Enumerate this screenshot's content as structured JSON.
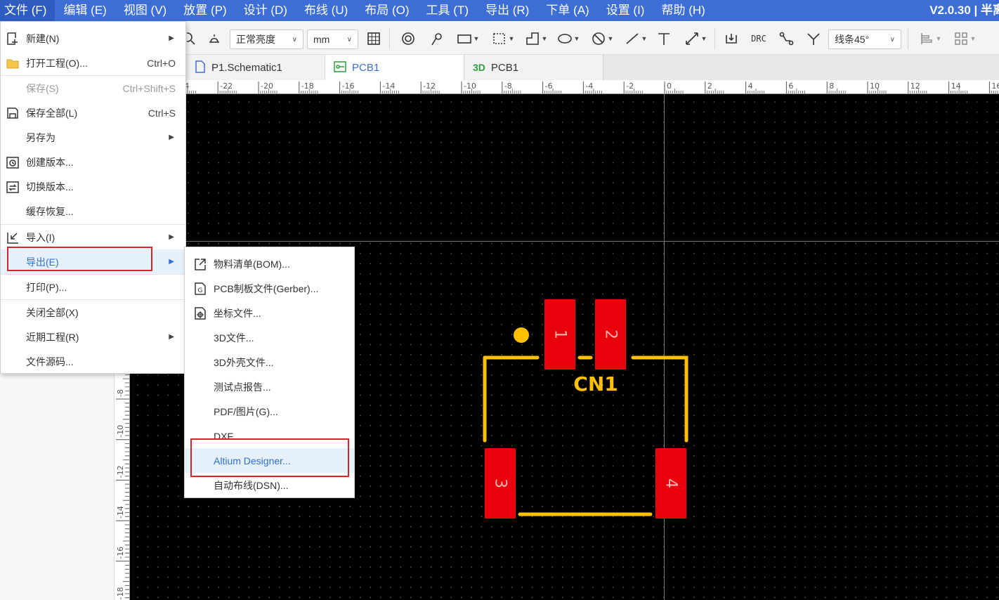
{
  "menubar": {
    "items": [
      "文件 (F)",
      "编辑 (E)",
      "视图 (V)",
      "放置 (P)",
      "设计 (D)",
      "布线 (U)",
      "布局 (O)",
      "工具 (T)",
      "导出 (R)",
      "下单 (A)",
      "设置 (I)",
      "帮助 (H)"
    ],
    "version": "V2.0.30 | 半离"
  },
  "toolbar": {
    "brightness": "正常亮度",
    "unit": "mm",
    "drc": "DRC",
    "routing_mode": "线条45°"
  },
  "tabs": [
    {
      "label": "P1.Schematic1",
      "icon": "schematic-icon"
    },
    {
      "label": "PCB1",
      "icon": "pcb-icon"
    },
    {
      "label": "PCB1",
      "prefix": "3D"
    }
  ],
  "ruler": {
    "top_ticks": [
      "24",
      "-22",
      "-20",
      "-18",
      "-16",
      "-14",
      "-12",
      "-10",
      "-8",
      "-6",
      "-4",
      "-2",
      "0",
      "2",
      "4",
      "6",
      "8",
      "10",
      "12",
      "14",
      "16"
    ],
    "left_ticks": [
      "-8",
      "-10",
      "-12",
      "-14",
      "-16",
      "-18"
    ]
  },
  "file_menu": {
    "items": [
      {
        "label": "新建(N)",
        "icon": "new-file-icon",
        "submenu": true
      },
      {
        "label": "打开工程(O)...",
        "icon": "folder-icon",
        "shortcut": "Ctrl+O"
      },
      {
        "label": "保存(S)",
        "shortcut": "Ctrl+Shift+S",
        "disabled": true
      },
      {
        "label": "保存全部(L)",
        "icon": "save-all-icon",
        "shortcut": "Ctrl+S"
      },
      {
        "label": "另存为",
        "submenu": true
      },
      {
        "label": "创建版本...",
        "icon": "create-version-icon"
      },
      {
        "label": "切换版本...",
        "icon": "switch-version-icon"
      },
      {
        "label": "缓存恢复..."
      },
      {
        "label": "导入(I)",
        "icon": "import-icon",
        "submenu": true
      },
      {
        "label": "导出(E)",
        "submenu": true,
        "highlighted": true
      },
      {
        "label": "打印(P)..."
      },
      {
        "label": "关闭全部(X)"
      },
      {
        "label": "近期工程(R)",
        "submenu": true
      },
      {
        "label": "文件源码..."
      }
    ]
  },
  "export_submenu": {
    "items": [
      {
        "label": "物料清单(BOM)...",
        "icon": "external-link-icon"
      },
      {
        "label": "PCB制板文件(Gerber)...",
        "icon": "gerber-file-icon"
      },
      {
        "label": "坐标文件...",
        "icon": "coordinate-file-icon"
      },
      {
        "label": "3D文件..."
      },
      {
        "label": "3D外壳文件..."
      },
      {
        "label": "测试点报告..."
      },
      {
        "label": "PDF/图片(G)..."
      },
      {
        "label": "DXF"
      },
      {
        "label": "Altium Designer...",
        "highlighted": true
      },
      {
        "label": "自动布线(DSN)..."
      }
    ]
  },
  "pcb": {
    "designator": "CN1",
    "pads": [
      "1",
      "2",
      "3",
      "4"
    ],
    "colors": {
      "pad": "#e8000b",
      "silk": "#ffc000",
      "background": "#000000"
    }
  }
}
